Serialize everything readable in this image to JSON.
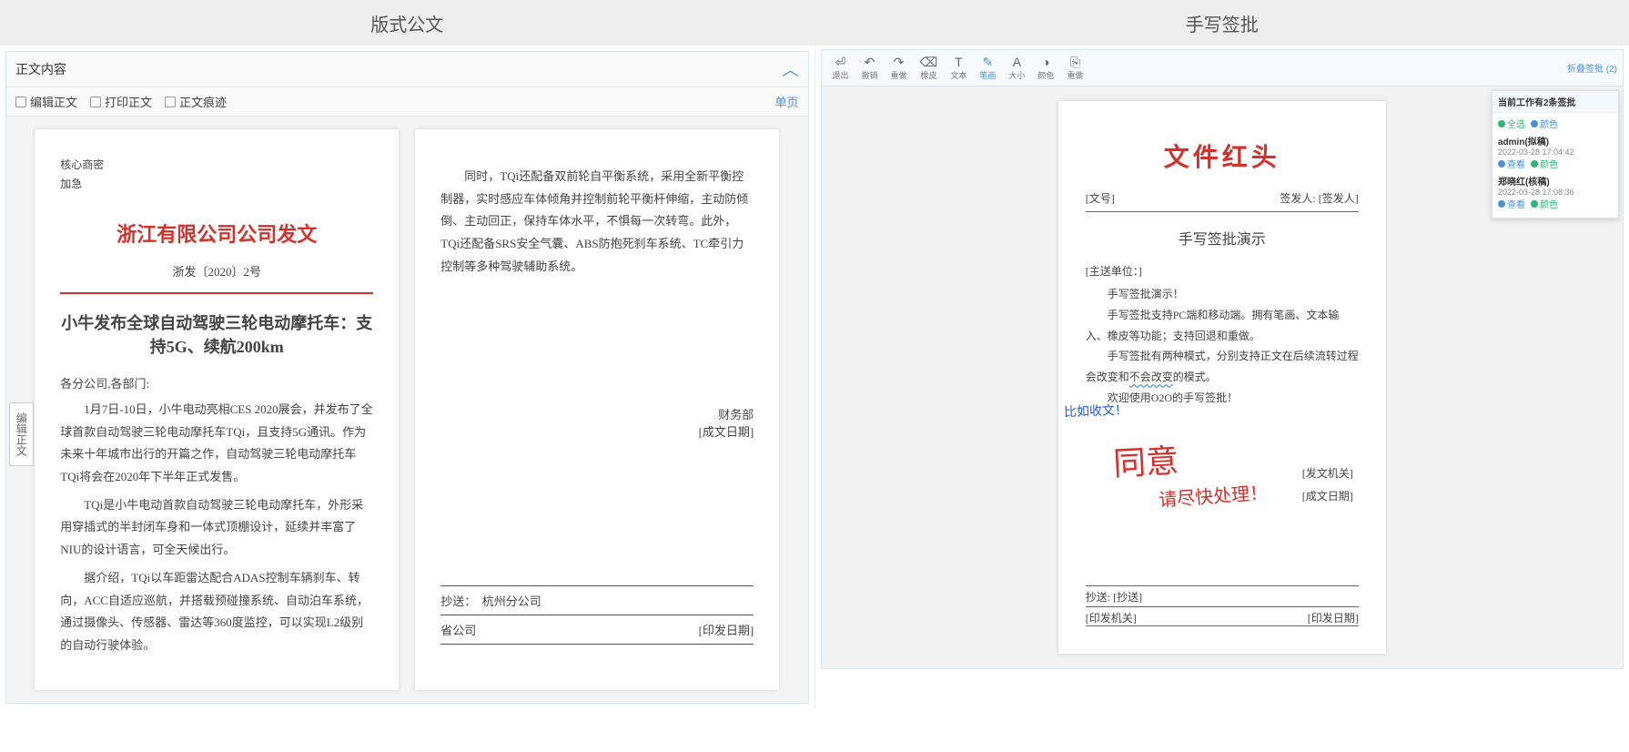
{
  "layout": {
    "left_header": "版式公文",
    "right_header": "手写签批"
  },
  "left": {
    "section_title": "正文内容",
    "toolbar": {
      "edit": "编辑正文",
      "print": "打印正文",
      "traces": "正文痕迹",
      "single_page": "单页"
    },
    "side_tab": "编辑正文",
    "doc": {
      "sec1": "核心商密",
      "sec2": "加急",
      "redhead": "浙江有限公司公司发文",
      "docnum": "浙发〔2020〕2号",
      "title": "小牛发布全球自动驾驶三轮电动摩托车：支持5G、续航200km",
      "addressee": "各分公司,各部门:",
      "p1": "1月7日-10日，小牛电动亮相CES 2020展会，并发布了全球首款自动驾驶三轮电动摩托车TQi，且支持5G通讯。作为未来十年城市出行的开篇之作，自动驾驶三轮电动摩托车TQi将会在2020年下半年正式发售。",
      "p2": "TQi是小牛电动首款自动驾驶三轮电动摩托车，外形采用穿插式的半封闭车身和一体式顶棚设计，延续并丰富了NIU的设计语言，可全天候出行。",
      "p3": "据介绍，TQi以车距雷达配合ADAS控制车辆刹车、转向，ACC自适应巡航，并搭载预碰撞系统、自动泊车系统，通过摄像头、传感器、雷达等360度监控，可以实现L2级别的自动行驶体验。"
    },
    "doc2": {
      "p1": "同时，TQi还配备双前轮自平衡系统，采用全新平衡控制器，实时感应车体倾角并控制前轮平衡杆伸缩，主动防倾倒、主动回正，保持车体水平，不惧每一次转弯。此外，TQi还配备SRS安全气囊、ABS防抱死刹车系统、TC牵引力控制等多种驾驶辅助系统。",
      "sign1": "财务部",
      "sign2": "[成文日期]",
      "copy_label": "抄送：",
      "copy_value": "杭州分公司",
      "issuer": "省公司",
      "issue_date": "[印发日期]"
    }
  },
  "right": {
    "toolbar": {
      "items": [
        {
          "glyph": "⏎",
          "label": "退出"
        },
        {
          "glyph": "↶",
          "label": "撤销"
        },
        {
          "glyph": "↷",
          "label": "重做"
        },
        {
          "glyph": "⌫",
          "label": "橡皮"
        },
        {
          "glyph": "T",
          "label": "文本"
        },
        {
          "glyph": "✎",
          "label": "笔画",
          "active": true
        },
        {
          "glyph": "A",
          "label": "大小"
        },
        {
          "glyph": "◑",
          "label": "颜色"
        },
        {
          "glyph": "⎘",
          "label": "重做"
        }
      ],
      "collapse": "折叠签批 (2)"
    },
    "panel": {
      "head": "当前工作有2条签批",
      "upload_tag": "全选",
      "color_tag": "颜色",
      "entries": [
        {
          "user": "admin(拟稿)",
          "time": "2022-03-28 17:04:42",
          "tag1": "查看",
          "tag2": "颜色"
        },
        {
          "user": "郑晓红(核稿)",
          "time": "2022-03-28 17:08:36",
          "tag1": "查看",
          "tag2": "颜色"
        }
      ]
    },
    "doc": {
      "redhead": "文件红头",
      "docnum": "[文号]",
      "signer": "签发人: [签发人]",
      "title": "手写签批演示",
      "addr": "[主送单位：]",
      "p1": "手写签批演示！",
      "p2": "手写签批支持PC端和移动端。拥有笔画、文本输入、橡皮等功能；支持回退和重做。",
      "p3_pre": "手写签批有两种模式，分别支持正文在后续流转过程会改变和",
      "p3_wavy": "不会改变",
      "p3_post": "的模式。",
      "p4": "欢迎使用O2O的手写签批！",
      "hand_blue": "比如收文！",
      "hand_red1": "同意",
      "hand_red2": "请尽快处理！",
      "sig_org": "[发文机关]",
      "sig_date": "[成文日期]",
      "footer": {
        "copy_label": "抄送:",
        "copy_val": "[抄送]",
        "issuer": "[印发机关]",
        "issue_date": "[印发日期]"
      }
    }
  }
}
